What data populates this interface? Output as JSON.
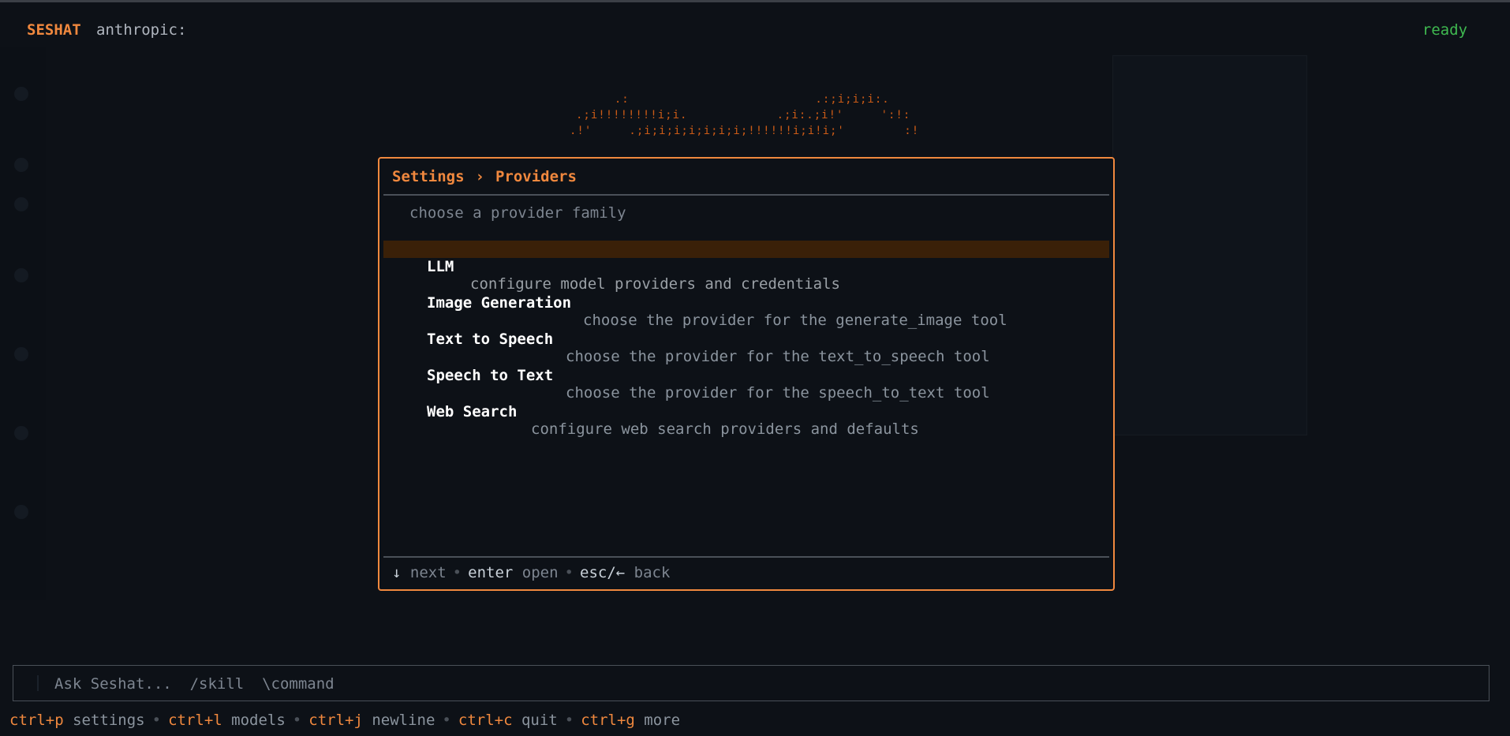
{
  "header": {
    "brand": "SESHAT",
    "provider": "anthropic:",
    "status": "ready"
  },
  "logo": {
    "line1": "  .:                         .:;i;i;i:.",
    "line2": ".;i!!!!!!!!i;i.            .;i:.;i!'     ':!:",
    "line3": ".!'     .;i;i;i;i;i;i;i;!!!!!!i;i!i;'        :!"
  },
  "modal": {
    "breadcrumb_root": "Settings",
    "breadcrumb_sep": "›",
    "breadcrumb_current": "Providers",
    "subtitle": "choose a provider family",
    "items": [
      {
        "name": "LLM",
        "desc": "configure model providers and credentials"
      },
      {
        "name": "Image Generation",
        "desc": "choose the provider for the generate_image tool"
      },
      {
        "name": "Text to Speech",
        "desc": "choose the provider for the text_to_speech tool"
      },
      {
        "name": "Speech to Text",
        "desc": "choose the provider for the speech_to_text tool"
      },
      {
        "name": "Web Search",
        "desc": "configure web search providers and defaults"
      }
    ],
    "hints": [
      {
        "key": "↓",
        "action": "next"
      },
      {
        "key": "enter",
        "action": "open"
      },
      {
        "key": "esc/←",
        "action": "back"
      }
    ]
  },
  "input": {
    "placeholder": "Ask Seshat...  /skill  \\command"
  },
  "shortcuts": [
    {
      "key": "ctrl+p",
      "label": "settings"
    },
    {
      "key": "ctrl+l",
      "label": "models"
    },
    {
      "key": "ctrl+j",
      "label": "newline"
    },
    {
      "key": "ctrl+c",
      "label": "quit"
    },
    {
      "key": "ctrl+g",
      "label": "more"
    }
  ]
}
